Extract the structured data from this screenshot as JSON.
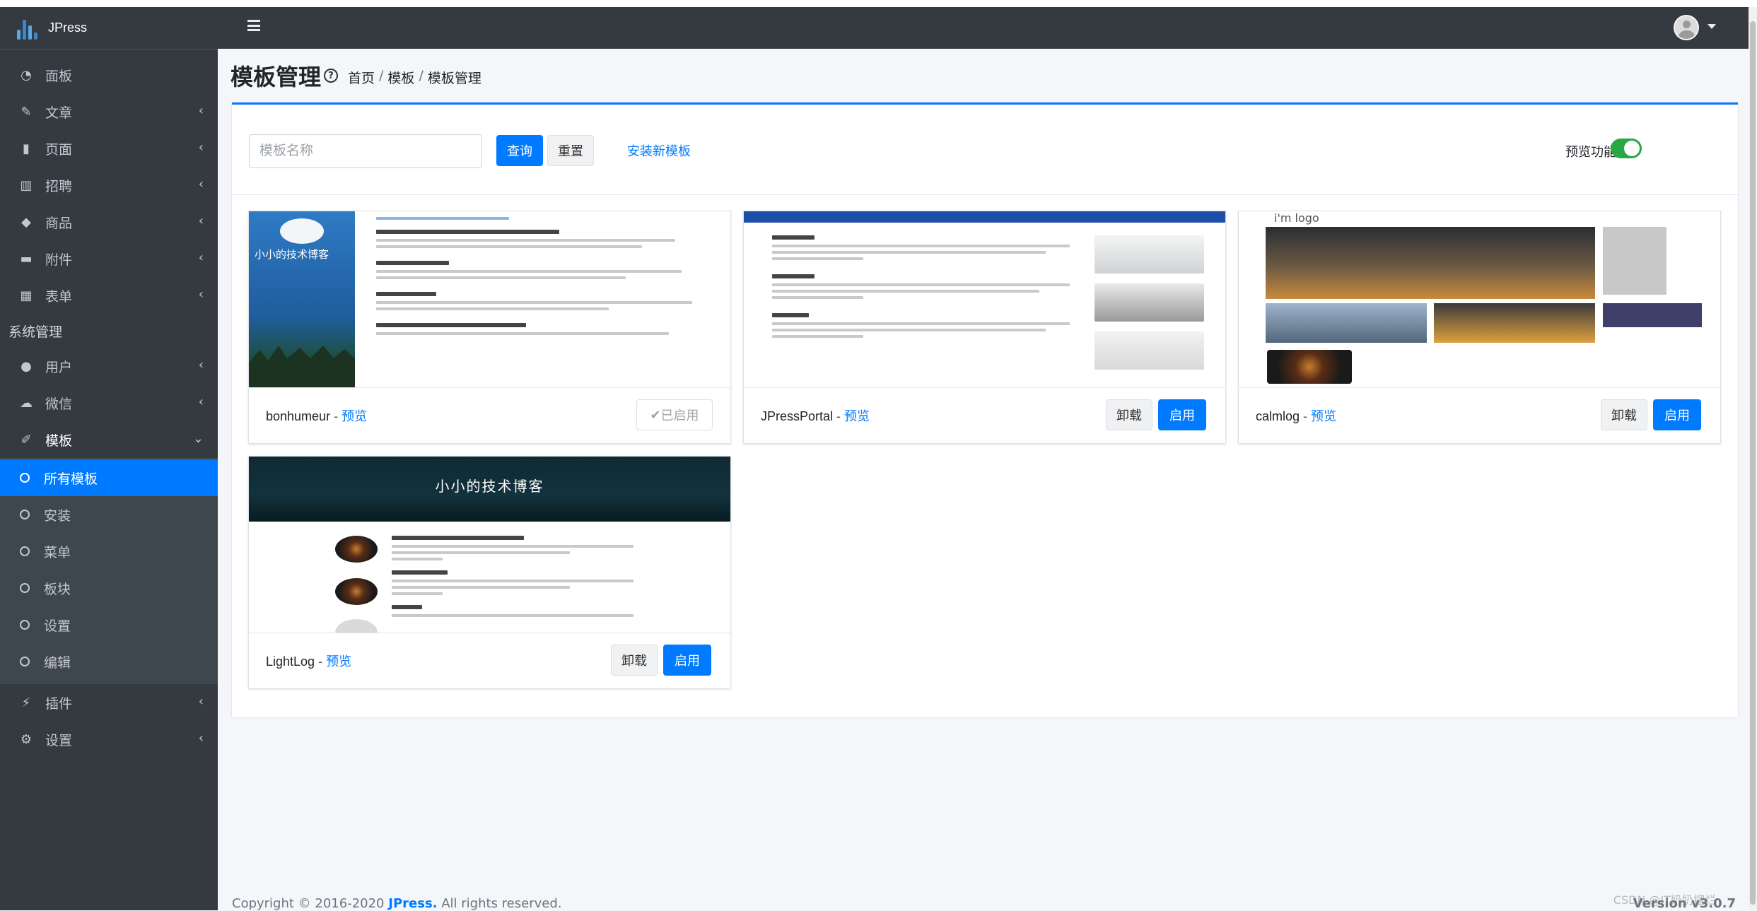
{
  "brand": {
    "name": "JPress"
  },
  "sidebar": {
    "items": [
      {
        "label": "面板",
        "icon": "dashboard-icon"
      },
      {
        "label": "文章",
        "icon": "edit-icon"
      },
      {
        "label": "页面",
        "icon": "file-icon"
      },
      {
        "label": "招聘",
        "icon": "chart-icon"
      },
      {
        "label": "商品",
        "icon": "tag-icon"
      },
      {
        "label": "附件",
        "icon": "folder-icon"
      },
      {
        "label": "表单",
        "icon": "table-icon"
      }
    ],
    "section_header": "系统管理",
    "system_items": [
      {
        "label": "用户",
        "icon": "user-icon"
      },
      {
        "label": "微信",
        "icon": "wechat-icon"
      },
      {
        "label": "模板",
        "icon": "brush-icon"
      }
    ],
    "template_sub": [
      {
        "label": "所有模板",
        "active": true
      },
      {
        "label": "安装"
      },
      {
        "label": "菜单"
      },
      {
        "label": "板块"
      },
      {
        "label": "设置"
      },
      {
        "label": "编辑"
      }
    ],
    "bottom_items": [
      {
        "label": "插件",
        "icon": "plug-icon"
      },
      {
        "label": "设置",
        "icon": "gear-icon"
      }
    ]
  },
  "header": {
    "title": "模板管理",
    "breadcrumb": [
      "首页",
      "模板",
      "模板管理"
    ]
  },
  "toolbar": {
    "search_placeholder": "模板名称",
    "query_label": "查询",
    "reset_label": "重置",
    "install_label": "安装新模板",
    "preview_label": "预览功能",
    "preview_enabled": true
  },
  "templates": [
    {
      "name": "bonhumeur",
      "preview": "预览",
      "enabled_label": "已启用",
      "thumb_title": "小小的技术博客"
    },
    {
      "name": "JPressPortal",
      "preview": "预览",
      "uninstall_label": "卸载",
      "enable_label": "启用"
    },
    {
      "name": "calmlog",
      "preview": "预览",
      "uninstall_label": "卸载",
      "enable_label": "启用",
      "thumb_title": "i'm logo"
    },
    {
      "name": "LightLog",
      "preview": "预览",
      "uninstall_label": "卸载",
      "enable_label": "启用",
      "thumb_title": "小小的技术博客"
    }
  ],
  "footer": {
    "copyright_prefix": "Copyright © 2016-2020",
    "copyright_brand": "JPress.",
    "copyright_suffix": "All rights reserved.",
    "version": "Version v3.0.7",
    "watermark": "CSDN @IT奶奶摆烂"
  },
  "colors": {
    "accent": "#007bff",
    "sidebar": "#343a40",
    "toggle_on": "#28a745"
  }
}
